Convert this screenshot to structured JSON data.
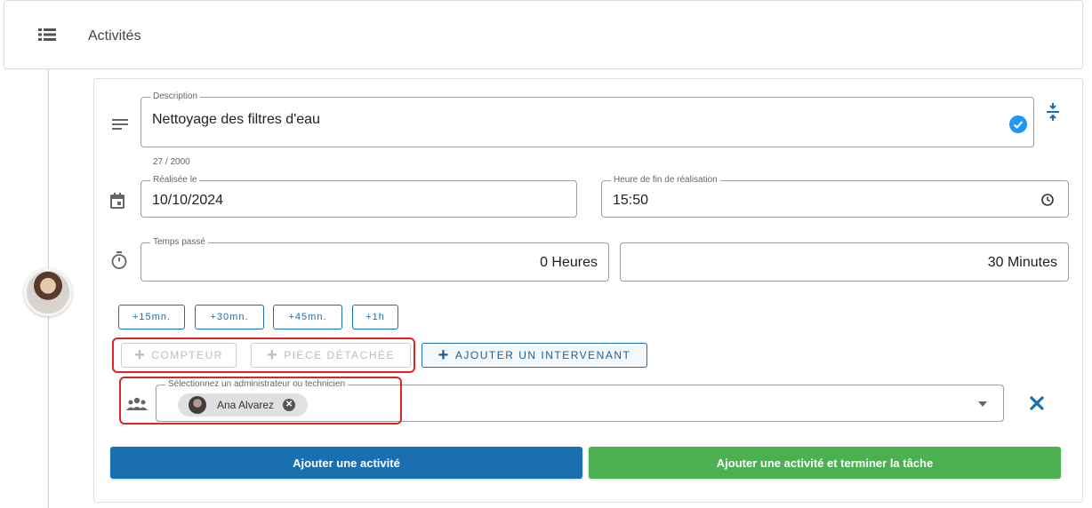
{
  "header": {
    "title": "Activités"
  },
  "description": {
    "legend": "Description",
    "value": "Nettoyage des filtres d'eau",
    "counter": "27 / 2000"
  },
  "date": {
    "legend": "Réalisée le",
    "value": "10/10/2024"
  },
  "end_time": {
    "legend": "Heure de fin de réalisation",
    "value": "15:50"
  },
  "time_spent": {
    "legend": "Temps passé",
    "hours": "0 Heures",
    "minutes": "30 Minutes"
  },
  "quick_add": [
    "+15mn.",
    "+30mn.",
    "+45mn.",
    "+1h"
  ],
  "actions": {
    "counter": "COMPTEUR",
    "spare_part": "PIÈCE DÉTACHÉE",
    "add_worker": "AJOUTER UN INTERVENANT"
  },
  "worker_select": {
    "legend": "Sélectionnez un administrateur ou technicien",
    "chip": "Ana Alvarez"
  },
  "buttons": {
    "add": "Ajouter une activité",
    "add_and_finish": "Ajouter une activité et terminer la tâche"
  },
  "colors": {
    "primary": "#1a6fb0",
    "success": "#4caf50",
    "highlight": "#e02424",
    "check": "#2196f3"
  }
}
